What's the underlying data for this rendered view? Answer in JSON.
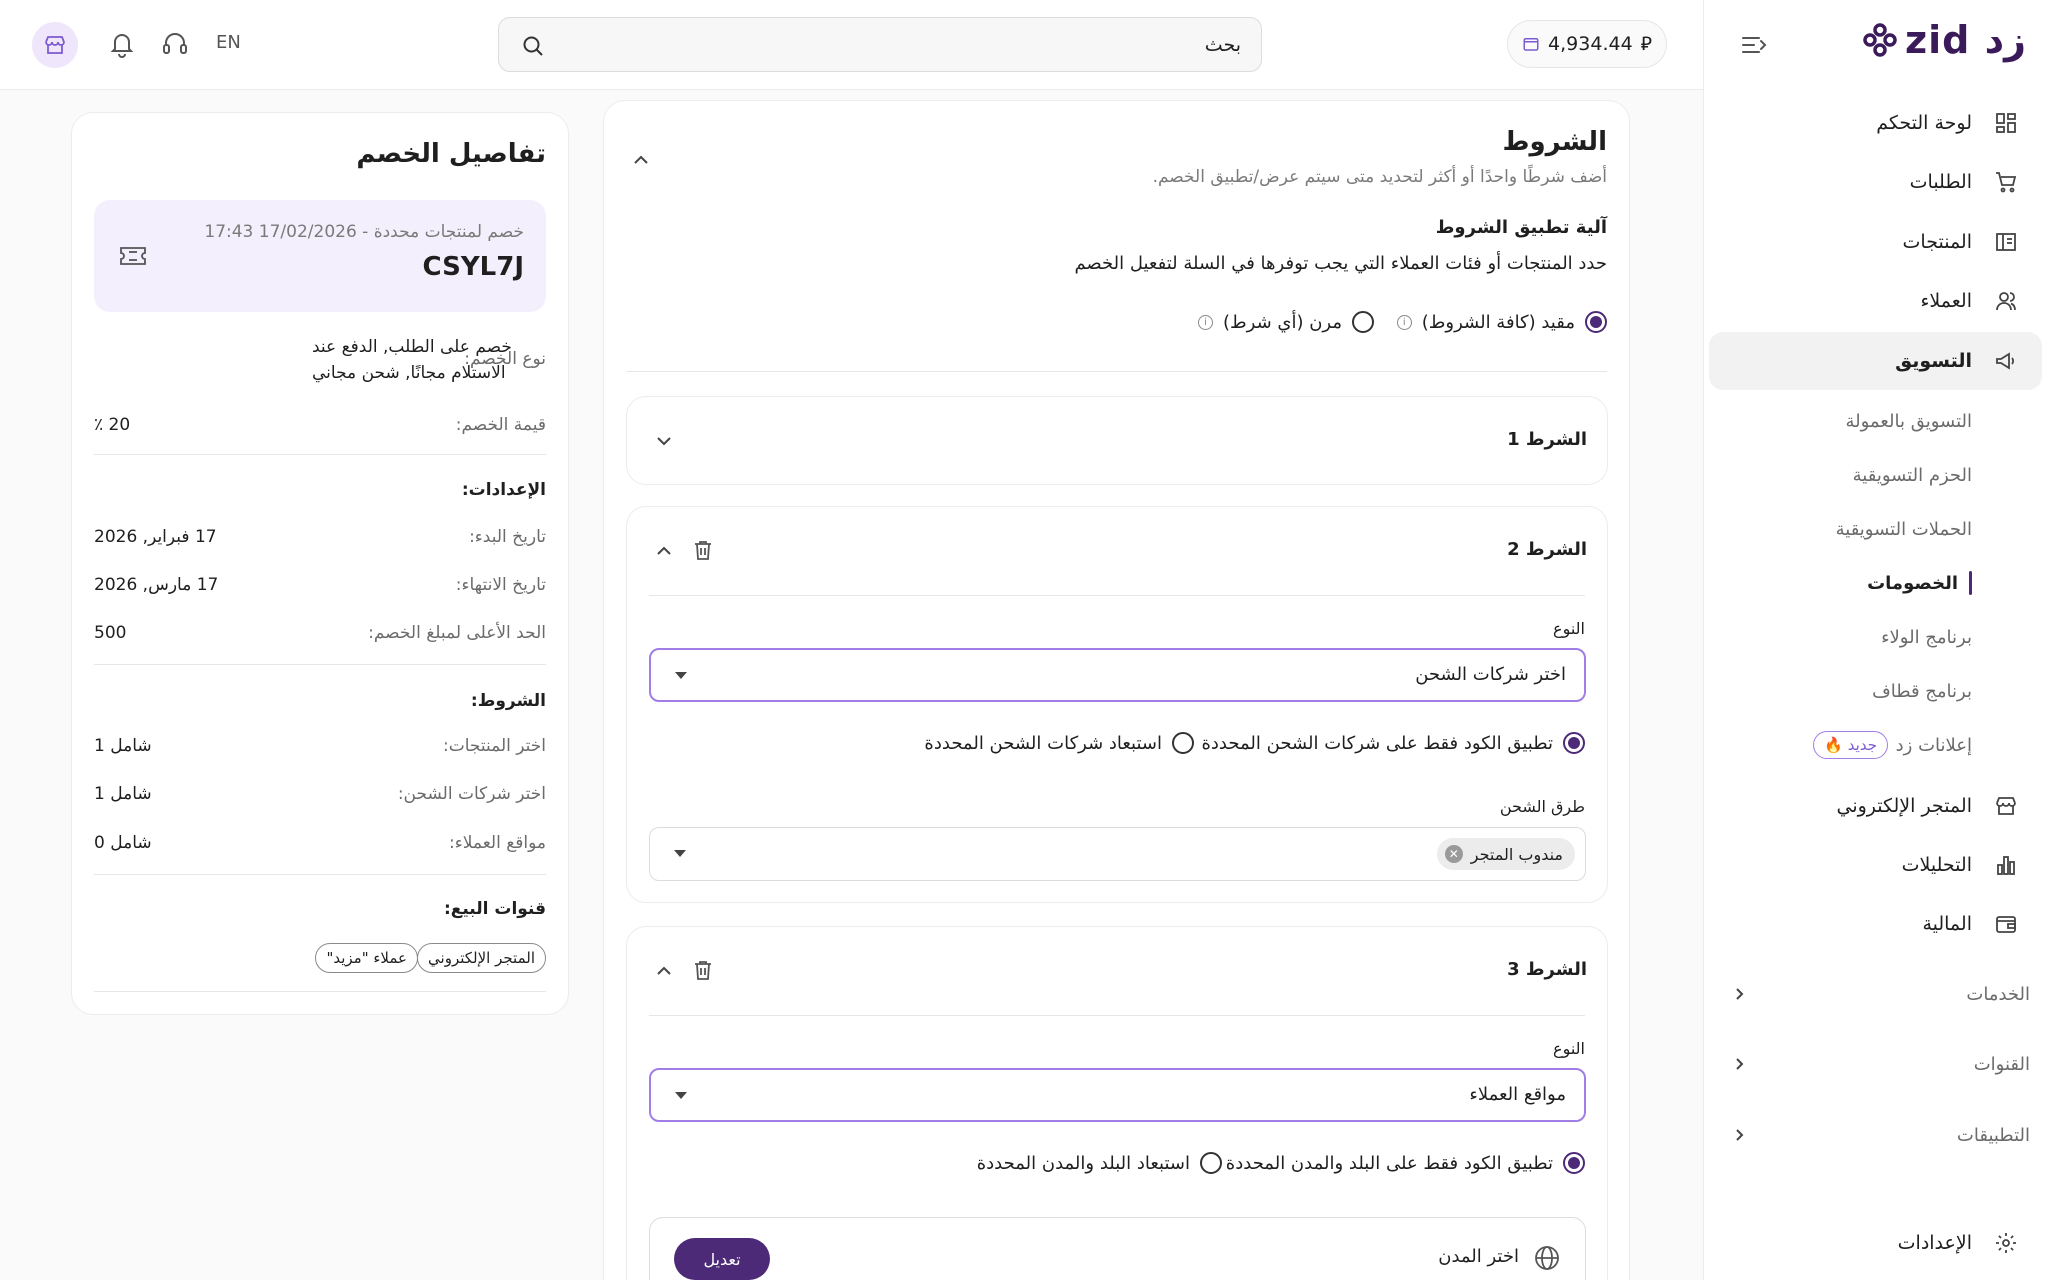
{
  "brand": {
    "logo_text": "zid زد"
  },
  "sidebar": {
    "items": [
      {
        "label": "لوحة التحكم",
        "icon": "dashboard-icon"
      },
      {
        "label": "الطلبات",
        "icon": "cart-icon"
      },
      {
        "label": "المنتجات",
        "icon": "products-icon"
      },
      {
        "label": "العملاء",
        "icon": "customers-icon"
      },
      {
        "label": "التسويق",
        "icon": "megaphone-icon"
      }
    ],
    "marketing_sub": [
      {
        "label": "التسويق بالعمولة"
      },
      {
        "label": "الحزم التسويقية"
      },
      {
        "label": "الحملات التسويقية"
      },
      {
        "label": "الخصومات"
      },
      {
        "label": "برنامج الولاء"
      },
      {
        "label": "برنامج قطاف"
      },
      {
        "label": "إعلانات زد"
      }
    ],
    "new_badge": "جديد 🔥",
    "items2": [
      {
        "label": "المتجر الإلكتروني",
        "icon": "store-icon"
      },
      {
        "label": "التحليلات",
        "icon": "analytics-icon"
      },
      {
        "label": "المالية",
        "icon": "wallet-icon"
      }
    ],
    "groups": [
      {
        "label": "الخدمات"
      },
      {
        "label": "القنوات"
      },
      {
        "label": "التطبيقات"
      }
    ],
    "settings": "الإعدادات"
  },
  "topbar": {
    "balance": "4,934.44",
    "currency_symbol": "⃁",
    "search_placeholder": "بحث",
    "language": "EN"
  },
  "conditions": {
    "title": "الشروط",
    "subtitle": "أضف شرطًا واحدًا أو أكثر لتحديد متى سيتم عرض/تطبيق الخصم.",
    "mechanism_title": "آلية تطبيق الشروط",
    "mechanism_desc": "حدد المنتجات أو فئات العملاء التي يجب توفرها في السلة لتفعيل الخصم",
    "option_strict": "مقيد (كافة الشروط)",
    "option_flexible": "مرن (أي شرط)",
    "cond1": {
      "title": "الشرط 1"
    },
    "cond2": {
      "title": "الشرط 2",
      "type_label": "النوع",
      "type_value": "اختر شركات الشحن",
      "opt_apply": "تطبيق الكود فقط على شركات الشحن المحددة",
      "opt_exclude": "استبعاد شركات الشحن المحددة",
      "methods_label": "طرق الشحن",
      "chip": "مندوب المتجر"
    },
    "cond3": {
      "title": "الشرط 3",
      "type_label": "النوع",
      "type_value": "مواقع العملاء",
      "opt_apply": "تطبيق الكود فقط على البلد والمدن المحددة",
      "opt_exclude": "استبعاد البلد والمدن المحددة",
      "cities_label": "اختر المدن",
      "edit_button": "تعديل"
    }
  },
  "details": {
    "title": "تفاصيل الخصم",
    "summary_line": "خصم لمنتجات محددة - 17/02/2026 17:43",
    "code": "CSYL7J",
    "type_label": "نوع الخصم:",
    "type_value_1": "خصم على الطلب, الدفع عند",
    "type_value_2": "الاستلام مجانًا, شحن مجاني",
    "value_label": "قيمة الخصم:",
    "value_value": "20 ٪",
    "settings_title": "الإعدادات:",
    "start_label": "تاريخ البدء:",
    "start_value": "17 فبراير, 2026",
    "end_label": "تاريخ الانتهاء:",
    "end_value": "17 مارس, 2026",
    "max_label": "الحد الأعلى لمبلغ الخصم:",
    "max_value": "500",
    "conditions_title": "الشروط:",
    "products_label": "اختر المنتجات:",
    "products_value": "شامل 1",
    "shipping_label": "اختر شركات الشحن:",
    "shipping_value": "شامل 1",
    "locations_label": "مواقع العملاء:",
    "locations_value": "شامل 0",
    "channels_title": "قنوات البيع:",
    "channel_1": "المتجر الإلكتروني",
    "channel_2": "عملاء \"مزيد\""
  }
}
